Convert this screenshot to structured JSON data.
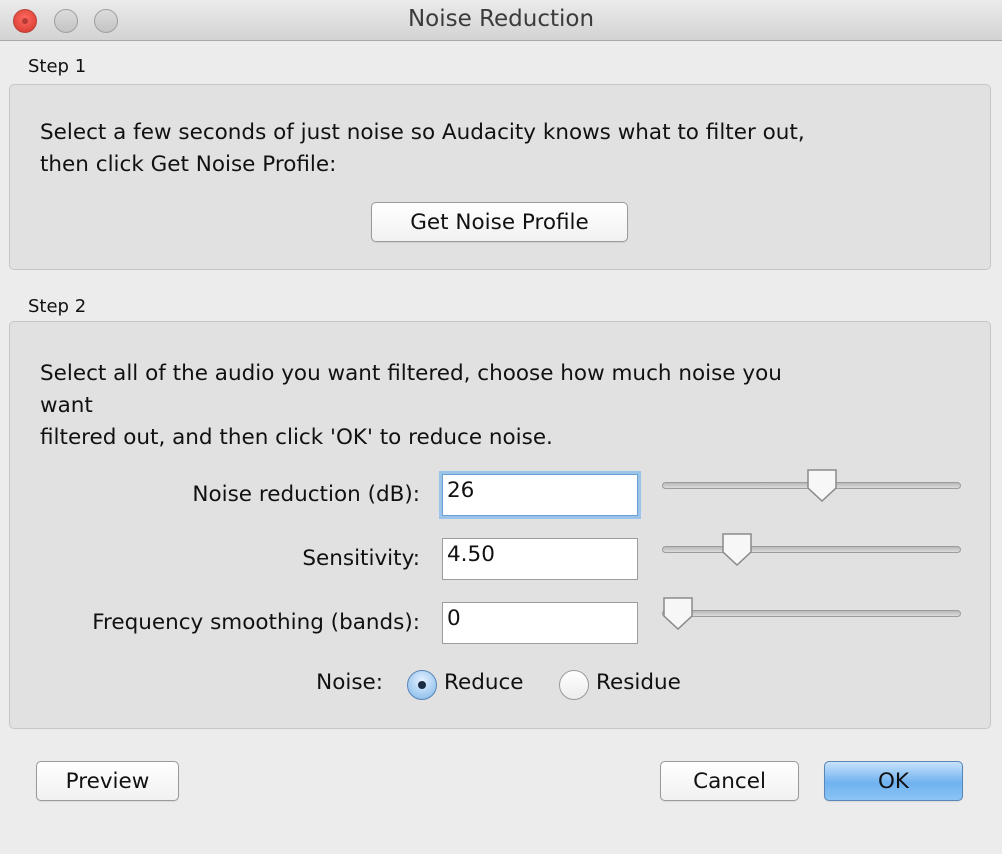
{
  "window": {
    "title": "Noise Reduction"
  },
  "step1": {
    "label": "Step 1",
    "instruction_line1": "Select a few seconds of just noise so Audacity knows what to filter out,",
    "instruction_line2": "then click Get Noise Profile:",
    "button_label": "Get Noise Profile"
  },
  "step2": {
    "label": "Step 2",
    "instruction_line1": "Select all of the audio you want filtered, choose how much noise you",
    "instruction_line2": "want",
    "instruction_line3": "filtered out, and then click 'OK' to reduce noise.",
    "fields": {
      "noise_reduction": {
        "label": "Noise reduction (dB):",
        "value": "26",
        "slider_fraction": 0.54
      },
      "sensitivity": {
        "label": "Sensitivity:",
        "value": "4.50",
        "slider_fraction": 0.22
      },
      "frequency_smoothing": {
        "label": "Frequency smoothing (bands):",
        "value": "0",
        "slider_fraction": 0.0
      }
    },
    "noise": {
      "label": "Noise:",
      "options": [
        {
          "label": "Reduce",
          "selected": true
        },
        {
          "label": "Residue",
          "selected": false
        }
      ]
    }
  },
  "buttons": {
    "preview": "Preview",
    "cancel": "Cancel",
    "ok": "OK"
  },
  "colors": {
    "accent": "#6fb2f0",
    "close": "#e0443b"
  }
}
